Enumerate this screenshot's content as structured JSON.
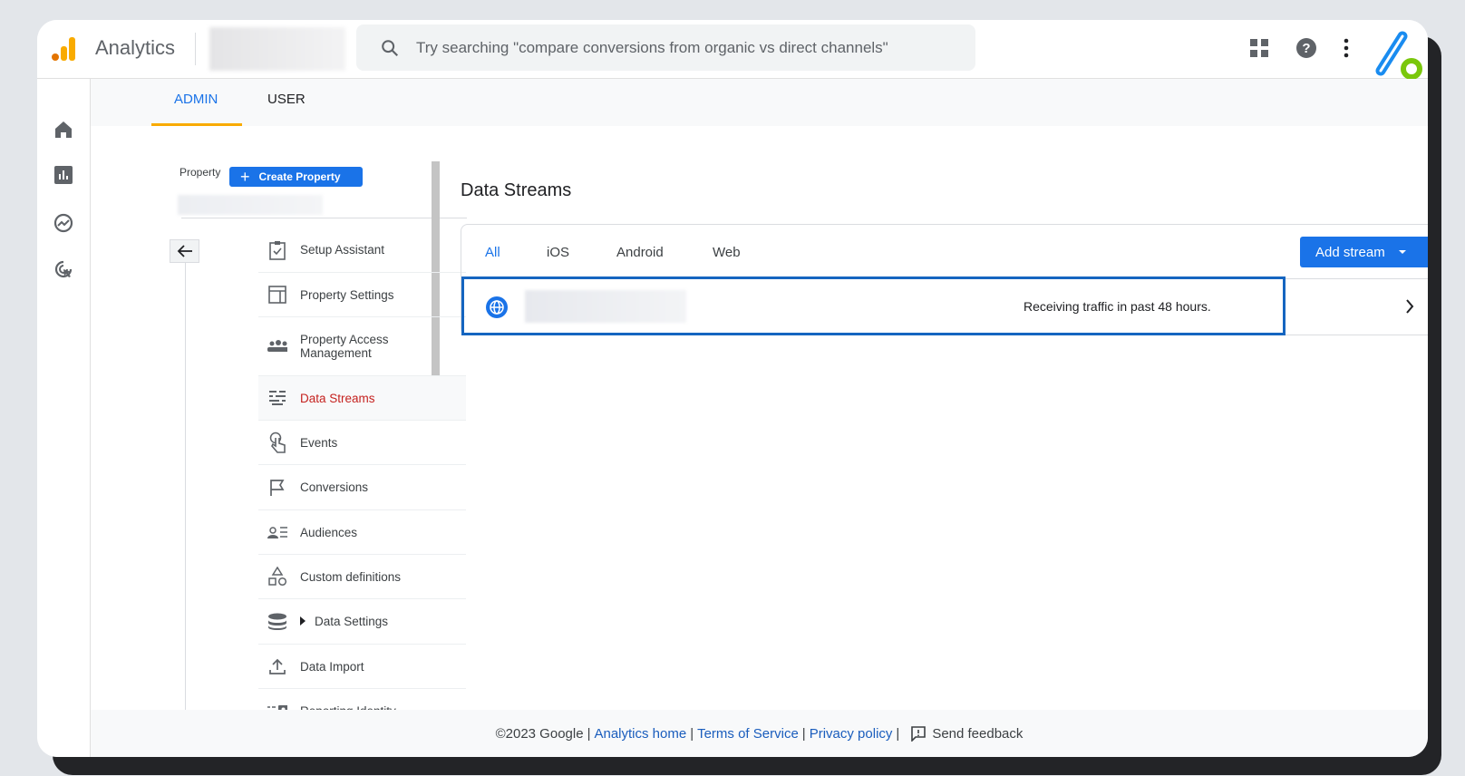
{
  "header": {
    "app_name": "Analytics",
    "search_placeholder": "Try searching \"compare conversions from organic vs direct channels\""
  },
  "tabs": [
    {
      "label": "ADMIN",
      "active": true
    },
    {
      "label": "USER",
      "active": false
    }
  ],
  "property": {
    "label": "Property",
    "create_button": "Create Property"
  },
  "menu": [
    {
      "label": "Setup Assistant",
      "icon": "clipboard-check-icon"
    },
    {
      "label": "Property Settings",
      "icon": "layout-icon"
    },
    {
      "label": "Property Access Management",
      "icon": "people-icon"
    },
    {
      "label": "Data Streams",
      "icon": "streams-icon",
      "active": true
    },
    {
      "label": "Events",
      "icon": "touch-icon"
    },
    {
      "label": "Conversions",
      "icon": "flag-icon"
    },
    {
      "label": "Audiences",
      "icon": "audience-icon"
    },
    {
      "label": "Custom definitions",
      "icon": "shapes-icon"
    },
    {
      "label": "Data Settings",
      "icon": "database-icon"
    },
    {
      "label": "Data Import",
      "icon": "upload-icon"
    },
    {
      "label": "Reporting Identity",
      "icon": "identity-icon"
    }
  ],
  "main": {
    "title": "Data Streams",
    "stream_tabs": [
      "All",
      "iOS",
      "Android",
      "Web"
    ],
    "add_stream": "Add stream",
    "stream_status": "Receiving traffic in past 48 hours."
  },
  "footer": {
    "copyright": "©2023 Google",
    "links": [
      "Analytics home",
      "Terms of Service",
      "Privacy policy"
    ],
    "feedback": "Send feedback",
    "sep": "|"
  },
  "colors": {
    "accent": "#1a73e8",
    "active_menu": "#c5221f",
    "tab_underline": "#f9ab00",
    "selection_border": "#1565c0"
  }
}
